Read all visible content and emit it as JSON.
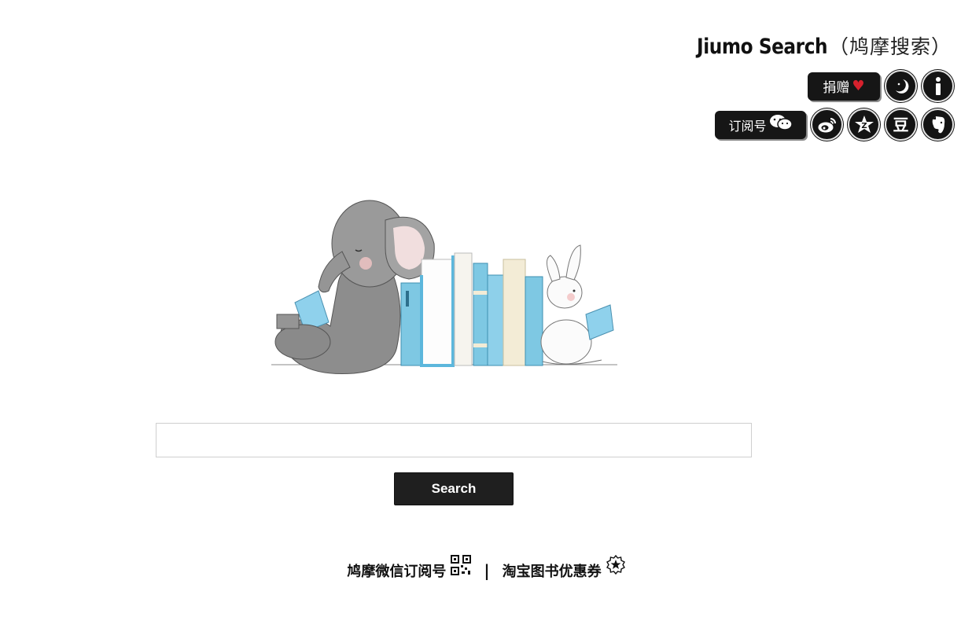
{
  "header": {
    "brand_main": "Jiumo Search",
    "brand_sub": "（鸠摩搜索）",
    "donate_label": "捐赠",
    "subscribe_label": "订阅号",
    "douban_label": "豆",
    "icons": [
      "heart-icon",
      "moon-icon",
      "info-icon",
      "wechat-icon",
      "weibo-icon",
      "zhihu-icon",
      "douban-icon",
      "evernote-icon"
    ]
  },
  "search": {
    "placeholder": "",
    "value": "",
    "button_label": "Search"
  },
  "footer": {
    "wechat_subscribe_label": "鸠摩微信订阅号",
    "separator": "|",
    "taobao_coupon_label": "淘宝图书优惠券"
  },
  "colors": {
    "background": "#ffffff",
    "button_bg": "#1f1f1f",
    "heart": "#d6212d",
    "book_blue": "#7ec8e3",
    "book_cream": "#f3ecd6"
  }
}
